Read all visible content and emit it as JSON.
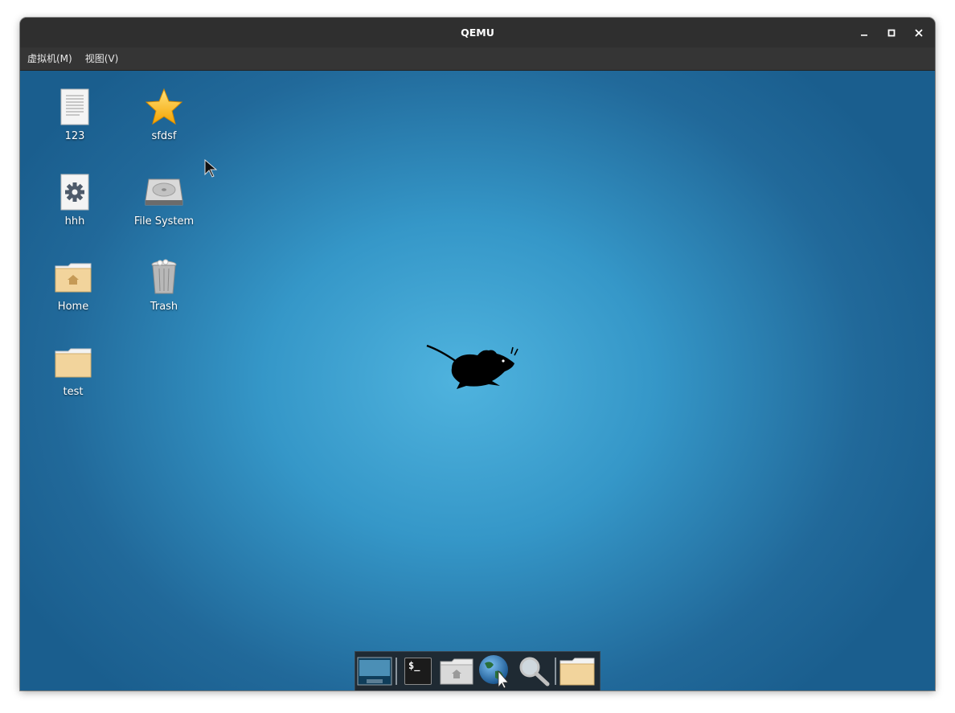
{
  "window": {
    "title": "QEMU",
    "controls": [
      "minimize-icon",
      "maximize-icon",
      "close-icon"
    ]
  },
  "menubar": {
    "items": [
      {
        "label": "虚拟机(M)"
      },
      {
        "label": "视图(V)"
      }
    ]
  },
  "desktop": {
    "icons": [
      {
        "label": "123",
        "icon": "text-document-icon"
      },
      {
        "label": "sfdsf",
        "icon": "star-icon"
      },
      {
        "label": "hhh",
        "icon": "settings-document-icon"
      },
      {
        "label": "File System",
        "icon": "hard-drive-icon"
      },
      {
        "label": "Home",
        "icon": "home-folder-icon"
      },
      {
        "label": "Trash",
        "icon": "trash-icon"
      },
      {
        "label": "test",
        "icon": "folder-icon"
      }
    ],
    "wallpaper_logo": "xfce-mouse-icon",
    "colors": {
      "wallpaper_center": "#4fb3de",
      "wallpaper_edge": "#1a5e8e",
      "titlebar": "#2f2f2f",
      "menubar": "#353535"
    }
  },
  "dock": {
    "items": [
      {
        "icon": "show-desktop-icon"
      },
      {
        "icon": "terminal-icon",
        "text": "$_"
      },
      {
        "icon": "home-folder-icon"
      },
      {
        "icon": "web-browser-icon"
      },
      {
        "icon": "search-icon"
      },
      {
        "icon": "folder-icon"
      }
    ]
  }
}
